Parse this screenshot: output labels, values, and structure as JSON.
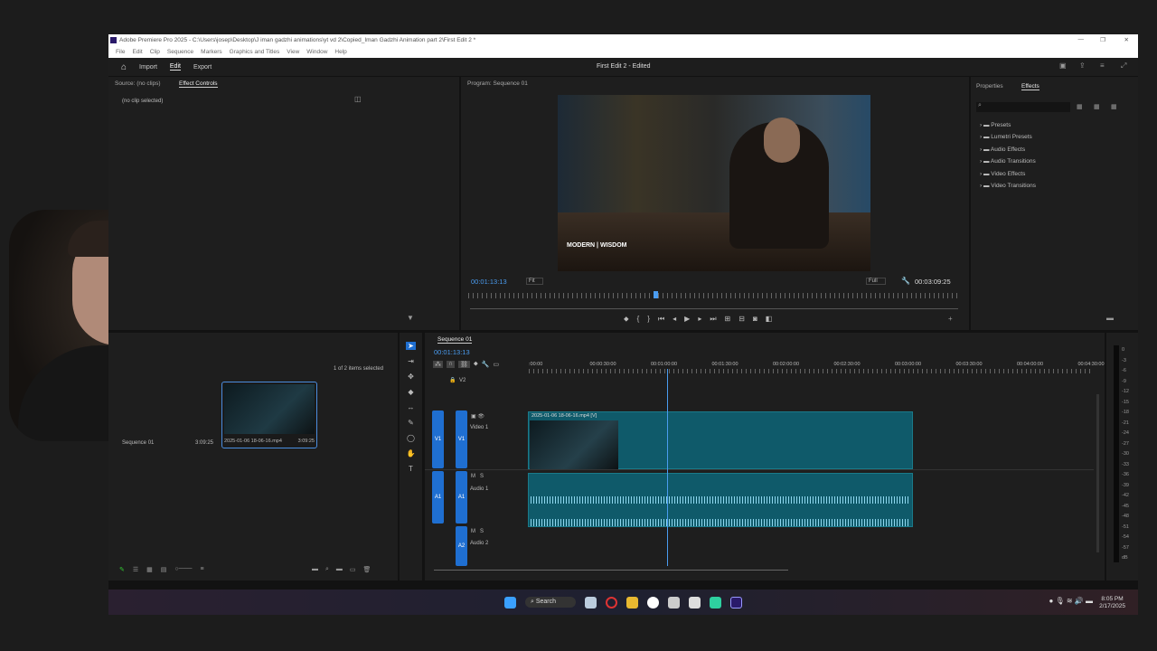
{
  "window": {
    "title": "Adobe Premiere Pro 2025 - C:\\Users\\josep\\Desktop\\J iman gadzhi animations\\yt vd 2\\Copied_Iman Gadzhi Animation part 2\\First Edit 2 *",
    "min": "—",
    "max": "❐",
    "close": "✕"
  },
  "menu": [
    "File",
    "Edit",
    "Clip",
    "Sequence",
    "Markers",
    "Graphics and Titles",
    "View",
    "Window",
    "Help"
  ],
  "header": {
    "import": "Import",
    "edit": "Edit",
    "export": "Export",
    "project_title": "First Edit 2 - Edited"
  },
  "source_panel": {
    "tab_source": "Source: (no clips)",
    "tab_effect_controls": "Effect Controls",
    "no_clip": "(no clip selected)"
  },
  "program": {
    "tab": "Program: Sequence 01",
    "timecode": "00:01:13:13",
    "fit": "Fit",
    "quality": "Full",
    "duration": "00:03:09:25",
    "video_logo": "MODERN | WISDOM",
    "playhead_fraction": 0.38
  },
  "effects_panel": {
    "tab_properties": "Properties",
    "tab_effects": "Effects",
    "search_placeholder": "",
    "items": [
      "Presets",
      "Lumetri Presets",
      "Audio Effects",
      "Audio Transitions",
      "Video Effects",
      "Video Transitions"
    ]
  },
  "project": {
    "selection": "1 of 2 items selected",
    "items": [
      {
        "name": "Sequence 01",
        "duration": "3:09:25"
      },
      {
        "name": "2025-01-06 18-06-16.mp4",
        "duration": "3:09:25"
      }
    ]
  },
  "timeline": {
    "tab": "Sequence 01",
    "timecode": "00:01:13:13",
    "ruler": [
      ":00:00",
      "00:00:30:00",
      "00:01:00:00",
      "00:01:30:00",
      "00:02:00:00",
      "00:02:30:00",
      "00:03:00:00",
      "00:03:30:00",
      "00:04:00:00",
      "00:04:30:00"
    ],
    "tracks": {
      "v2": "V2",
      "v1": "V1",
      "video1": "Video 1",
      "a1": "A1",
      "audio1": "Audio 1",
      "a2": "A2",
      "audio2": "Audio 2",
      "m": "M",
      "s": "S"
    },
    "clip_name": "2025-01-06 18-06-16.mp4 [V]"
  },
  "meter": [
    "0",
    "-3",
    "-6",
    "-9",
    "-12",
    "-15",
    "-18",
    "-21",
    "-24",
    "-27",
    "-30",
    "-33",
    "-36",
    "-39",
    "-42",
    "-45",
    "-48",
    "-51",
    "-54",
    "-57",
    "dB"
  ],
  "taskbar": {
    "search": "Search",
    "time": "8:05 PM",
    "date": "2/17/2025"
  }
}
